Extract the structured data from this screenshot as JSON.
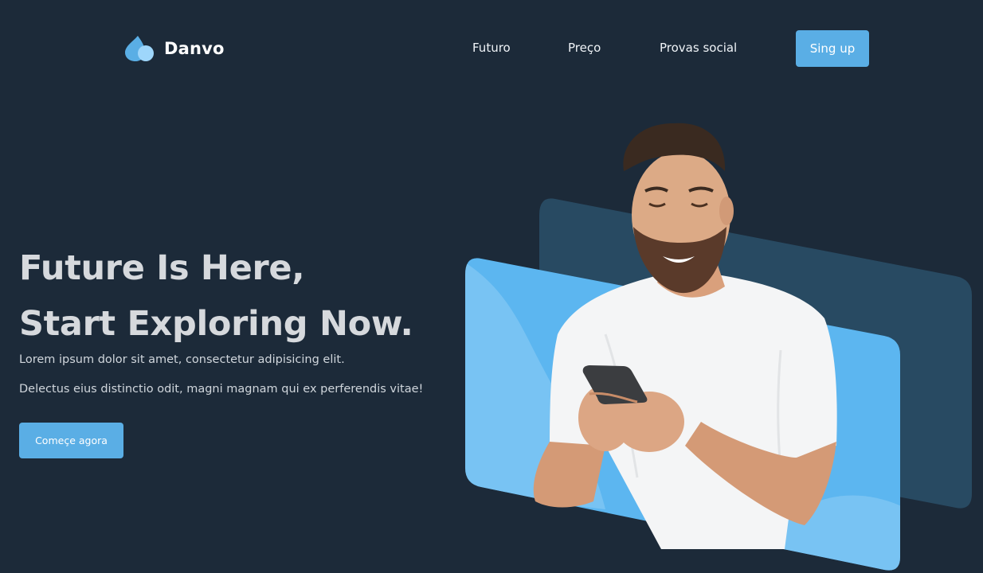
{
  "brand": {
    "name": "Danvo",
    "logo_icon": "water-drop-icon",
    "accent_color": "#5aaee5"
  },
  "nav": {
    "items": [
      "Futuro",
      "Preço",
      "Provas social"
    ],
    "signup_label": "Sing up"
  },
  "hero": {
    "title_line1": "Future Is Here,",
    "title_line2": "Start Exploring Now.",
    "text_line1": "Lorem ipsum dolor sit amet, consectetur adipisicing elit.",
    "text_line2": "Delectus eius distinctio odit, magni magnam qui ex perferendis vitae!",
    "cta_label": "Começe agora"
  },
  "colors": {
    "background": "#1c2a39",
    "back_panel": "#284a62",
    "front_panel": "#5cb6f0",
    "wave_light": "#8fcdf6"
  }
}
